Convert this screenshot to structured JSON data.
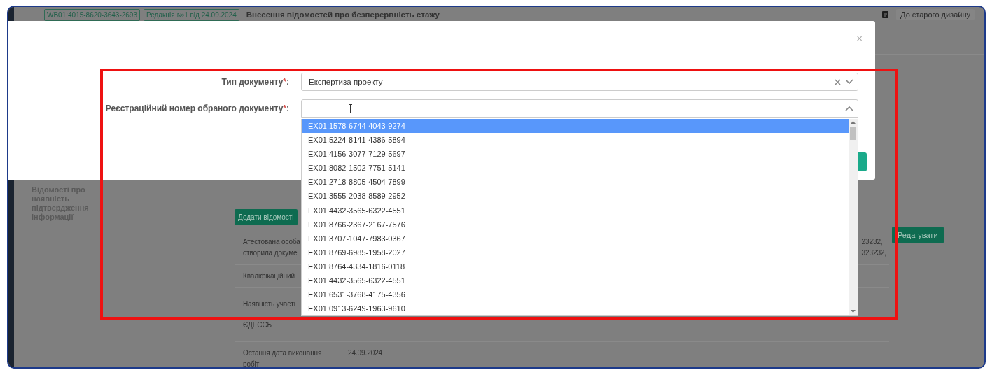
{
  "page": {
    "badges": [
      "WB01:4015-8620-3643-2693",
      "Редакція №1 від 24.09.2024"
    ],
    "title": "Внесення відомостей про безперервність стажу",
    "old_design_link": "До старого дизайну",
    "section": {
      "heading": "Відомості про наявність підтвердження інформації",
      "add_button": "Додати відомості",
      "edit_button": "Редагувати",
      "rows": [
        {
          "label": [
            "Атестована особа",
            "створила докуме"
          ],
          "value_end": [
            "23232,",
            "323232,"
          ]
        },
        {
          "label": [
            "Кваліфікаційний"
          ]
        },
        {
          "label": [
            "Наявність участі",
            "ЄДЕССБ"
          ]
        },
        {
          "label": [
            "Остання дата виконання",
            "робіт"
          ],
          "value": [
            "24.09.2024"
          ]
        }
      ]
    }
  },
  "modal": {
    "close": "×",
    "fields": [
      {
        "label": "Тип документу",
        "required_mark": "*",
        "label_end": ":",
        "value": "Експертиза проекту",
        "expanded": false
      },
      {
        "label": "Реєстраційний номер обраного документу",
        "required_mark": "*",
        "label_end": ":",
        "expanded": true
      }
    ],
    "options": [
      {
        "text": "EX01:1578-6744-4043-9274",
        "selected": true
      },
      {
        "text": "EX01:5224-8141-4386-5894",
        "selected": false
      },
      {
        "text": "EX01:4156-3077-7129-5697",
        "selected": false
      },
      {
        "text": "EX01:8082-1502-7751-5141",
        "selected": false
      },
      {
        "text": "EX01:2718-8805-4504-7899",
        "selected": false
      },
      {
        "text": "EX01:3555-2038-8589-2952",
        "selected": false
      },
      {
        "text": "EX01:4432-3565-6322-4551",
        "selected": false
      },
      {
        "text": "EX01:8766-2367-2167-7576",
        "selected": false
      },
      {
        "text": "EX01:3707-1047-7983-0367",
        "selected": false
      },
      {
        "text": "EX01:8769-6985-1958-2027",
        "selected": false
      },
      {
        "text": "EX01:8764-4334-1816-0118",
        "selected": false
      },
      {
        "text": "EX01:4432-3565-6322-4551",
        "selected": false
      },
      {
        "text": "EX01:6531-3768-4175-4356",
        "selected": false
      },
      {
        "text": "EX01:0913-6249-1963-9610",
        "selected": false
      }
    ]
  }
}
